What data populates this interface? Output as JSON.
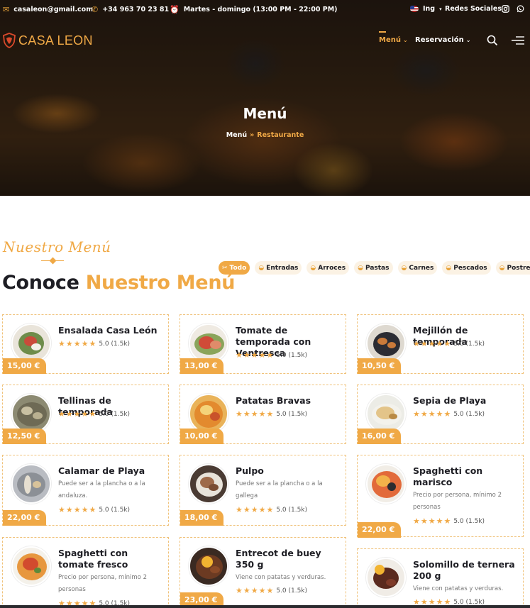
{
  "topbar": {
    "email": "casaleon@gmail.com",
    "phone": "+34 963 70 23 81",
    "hours": "Martes - domingo (13:00 PM - 22:00 PM)",
    "language": "Ing",
    "social": "Redes Sociales"
  },
  "navbar": {
    "logo_text": "CASA LEON",
    "menu_label": "Menú",
    "reservation_label": "Reservación"
  },
  "hero": {
    "title": "Menú",
    "breadcrumb_home": "Menú",
    "breadcrumb_current": "Restaurante"
  },
  "section": {
    "subtitle": "Nuestro Menú",
    "heading_dark": "Conoce",
    "heading_gold": "Nuestro Menú"
  },
  "filters": [
    "Todo",
    "Entradas",
    "Arroces",
    "Pastas",
    "Carnes",
    "Pescados",
    "Postres"
  ],
  "dishes": [
    {
      "name": "Ensalada Casa León",
      "desc": "",
      "rating": "5.0 (1.5k)",
      "price": "15,00 €"
    },
    {
      "name": "Tomate de temporada con Ventresca",
      "desc": "",
      "rating": "5.0 (1.5k)",
      "price": "13,00 €"
    },
    {
      "name": "Mejillón de temporada",
      "desc": "",
      "rating": "5.0 (1.5k)",
      "price": "10,50 €"
    },
    {
      "name": "Tellinas de temporada",
      "desc": "",
      "rating": "5.0 (1.5k)",
      "price": "12,50 €"
    },
    {
      "name": "Patatas Bravas",
      "desc": "",
      "rating": "5.0 (1.5k)",
      "price": "10,00 €"
    },
    {
      "name": "Sepia de Playa",
      "desc": "",
      "rating": "5.0 (1.5k)",
      "price": "16,00 €"
    },
    {
      "name": "Calamar de Playa",
      "desc": "Puede ser a la plancha o a la andaluza.",
      "rating": "5.0 (1.5k)",
      "price": "22,00 €"
    },
    {
      "name": "Pulpo",
      "desc": "Puede ser a la plancha o a la gallega",
      "rating": "5.0 (1.5k)",
      "price": "18,00 €"
    },
    {
      "name": "Spaghetti con marisco",
      "desc": "Precio por persona, mínimo 2 personas",
      "rating": "5.0 (1.5k)",
      "price": "22,00 €"
    },
    {
      "name": "Spaghetti con tomate fresco",
      "desc": "Precio por persona, mínimo 2 personas",
      "rating": "5.0 (1.5k)",
      "price": ""
    },
    {
      "name": "Entrecot de buey 350 g",
      "desc": "Viene con patatas y verduras.",
      "rating": "5.0 (1.5k)",
      "price": "23,00 €"
    },
    {
      "name": "Solomillo de ternera 200 g",
      "desc": "Viene con patatas y verduras.",
      "rating": "5.0 (1.5k)",
      "price": ""
    }
  ],
  "stars": "★★★★★",
  "colors": {
    "accent": "#f0a946",
    "dark": "#1e1e24",
    "brand_red": "#d9492b"
  }
}
